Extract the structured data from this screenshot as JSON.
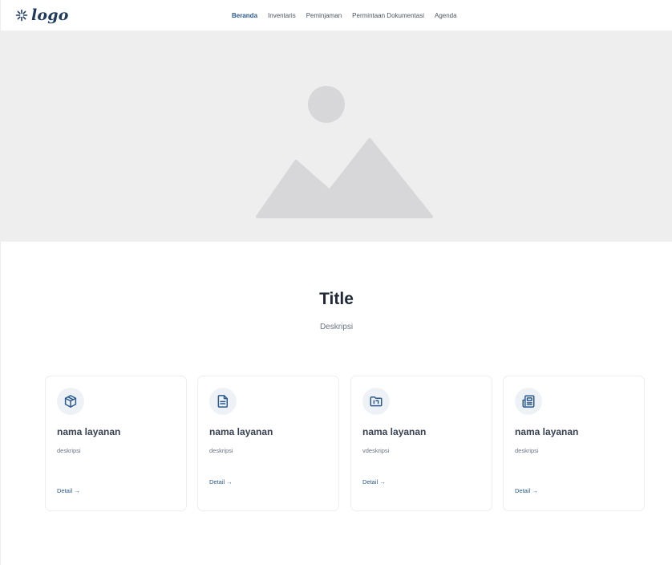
{
  "header": {
    "logo_text": "logo",
    "nav": [
      {
        "label": "Beranda",
        "active": true
      },
      {
        "label": "Inventaris",
        "active": false
      },
      {
        "label": "Peminjaman",
        "active": false
      },
      {
        "label": "Permintaan Dokumentasi",
        "active": false
      },
      {
        "label": "Agenda",
        "active": false
      }
    ]
  },
  "hero": {
    "icon": "image-placeholder-icon"
  },
  "section": {
    "title": "Title",
    "description": "Deskripsi"
  },
  "cards": [
    {
      "icon": "box-icon",
      "title": "nama layanan",
      "description": "deskripsi",
      "link": "Detail →"
    },
    {
      "icon": "document-icon",
      "title": "nama layanan",
      "description": "deskripsi",
      "link": "Detail →"
    },
    {
      "icon": "folder-icon",
      "title": "nama layanan",
      "description": "vdeskripsi",
      "link": "Detail →"
    },
    {
      "icon": "newspaper-icon",
      "title": "nama layanan",
      "description": "deskripsi",
      "link": "Detail →"
    }
  ],
  "colors": {
    "accent": "#2b5a8e",
    "hero_background": "#eeeeef",
    "placeholder_shape": "#d7d7d9"
  }
}
